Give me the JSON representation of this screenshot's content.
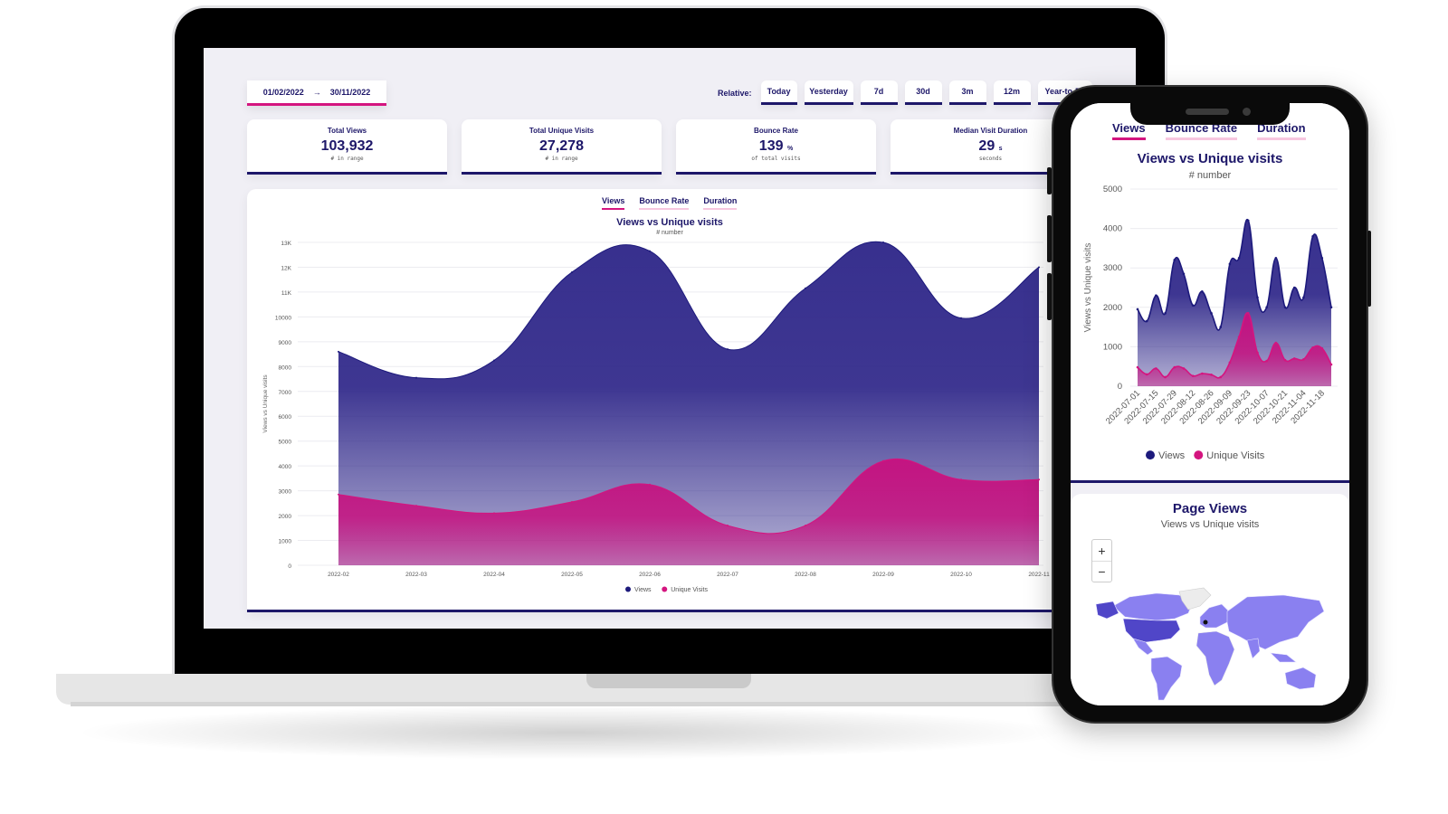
{
  "laptop": {
    "date_range": {
      "start": "01/02/2022",
      "arrow": "→",
      "end": "30/11/2022"
    },
    "relative": {
      "label": "Relative:",
      "buttons": [
        "Today",
        "Yesterday",
        "7d",
        "30d",
        "3m",
        "12m",
        "Year-to-D"
      ]
    },
    "kpis": [
      {
        "title": "Total Views",
        "value": "103,932",
        "unit": "",
        "sub": "# in range"
      },
      {
        "title": "Total Unique Visits",
        "value": "27,278",
        "unit": "",
        "sub": "# in range"
      },
      {
        "title": "Bounce Rate",
        "value": "139",
        "unit": "%",
        "sub": "of total visits"
      },
      {
        "title": "Median Visit Duration",
        "value": "29",
        "unit": "s",
        "sub": "seconds"
      }
    ],
    "tabs": [
      {
        "label": "Views",
        "active": true
      },
      {
        "label": "Bounce Rate",
        "active": false
      },
      {
        "label": "Duration",
        "active": false
      }
    ]
  },
  "phone": {
    "tabs": [
      {
        "label": "Views",
        "active": true
      },
      {
        "label": "Bounce Rate",
        "active": false
      },
      {
        "label": "Duration",
        "active": false
      }
    ],
    "map_card": {
      "title": "Page Views",
      "subtitle": "Views vs Unique visits",
      "zoom_in": "+",
      "zoom_out": "−"
    }
  },
  "colors": {
    "views": "#1d1a7c",
    "unique": "#d4157f",
    "map_fill": "#8a80f0",
    "map_highlight": "#5046c8",
    "map_empty": "#ececec"
  },
  "chart_data": [
    {
      "type": "area",
      "title": "Views vs Unique visits",
      "subtitle": "# number",
      "xlabel": "",
      "ylabel": "Views vs Unique visits",
      "categories": [
        "2022-02",
        "2022-03",
        "2022-04",
        "2022-05",
        "2022-06",
        "2022-07",
        "2022-08",
        "2022-09",
        "2022-10",
        "2022-11"
      ],
      "ylim": [
        0,
        13000
      ],
      "yticks": [
        0,
        1000,
        2000,
        3000,
        4000,
        5000,
        6000,
        7000,
        8000,
        9000,
        10000,
        11000,
        12000,
        13000
      ],
      "ytick_labels": [
        "0",
        "1000",
        "2000",
        "3000",
        "4000",
        "5000",
        "6000",
        "7000",
        "8000",
        "9000",
        "10000",
        "11K",
        "12K",
        "13K"
      ],
      "grid": true,
      "legend": "bottom",
      "series": [
        {
          "name": "Views",
          "values": [
            8600,
            7550,
            8250,
            11800,
            12650,
            8700,
            11150,
            13000,
            9950,
            12000
          ]
        },
        {
          "name": "Unique Visits",
          "values": [
            2850,
            2400,
            2100,
            2550,
            3250,
            1600,
            1600,
            4200,
            3450,
            3450
          ]
        }
      ]
    },
    {
      "type": "area",
      "title": "Views vs Unique visits",
      "subtitle": "# number",
      "xlabel": "",
      "ylabel": "Views vs Unique visits",
      "x": [
        "2022-07-01",
        "2022-07-08",
        "2022-07-15",
        "2022-07-22",
        "2022-07-29",
        "2022-08-05",
        "2022-08-12",
        "2022-08-19",
        "2022-08-26",
        "2022-09-02",
        "2022-09-09",
        "2022-09-16",
        "2022-09-23",
        "2022-09-30",
        "2022-10-07",
        "2022-10-14",
        "2022-10-21",
        "2022-10-28",
        "2022-11-04",
        "2022-11-11",
        "2022-11-18",
        "2022-11-25"
      ],
      "xtick_labels": [
        "2022-07-01",
        "2022-07-15",
        "2022-07-29",
        "2022-08-12",
        "2022-08-26",
        "2022-09-09",
        "2022-09-23",
        "2022-10-07",
        "2022-10-21",
        "2022-11-04",
        "2022-11-18"
      ],
      "ylim": [
        0,
        5000
      ],
      "yticks": [
        0,
        1000,
        2000,
        3000,
        4000,
        5000
      ],
      "grid": true,
      "legend": "bottom",
      "series": [
        {
          "name": "Views",
          "values": [
            1950,
            1650,
            2300,
            1850,
            3200,
            2850,
            2050,
            2400,
            1850,
            1500,
            3100,
            3250,
            4200,
            2250,
            2000,
            3250,
            2000,
            2500,
            2250,
            3800,
            3250,
            2000
          ]
        },
        {
          "name": "Unique Visits",
          "values": [
            480,
            300,
            450,
            230,
            480,
            450,
            260,
            320,
            290,
            230,
            600,
            1250,
            1850,
            850,
            640,
            1100,
            660,
            700,
            680,
            980,
            960,
            550
          ]
        }
      ]
    }
  ]
}
